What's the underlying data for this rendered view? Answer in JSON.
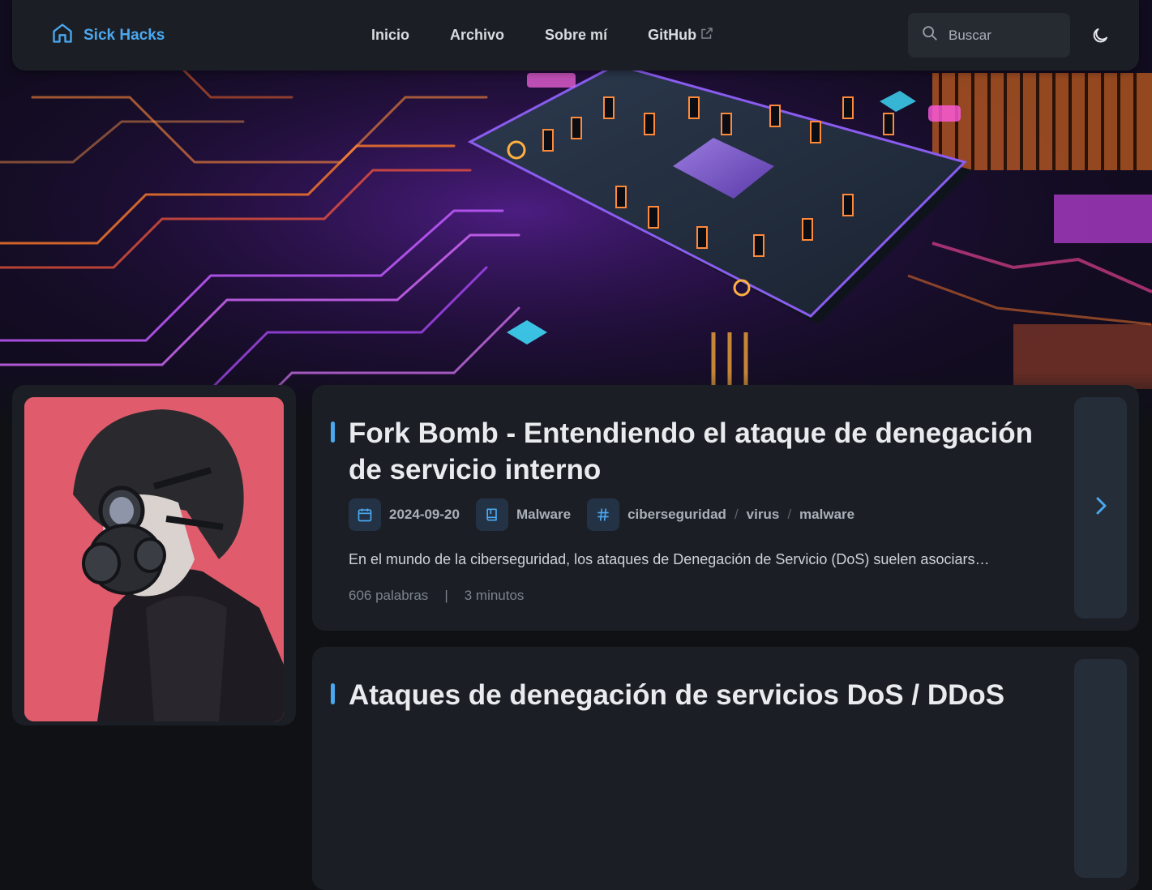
{
  "navbar": {
    "brand": "Sick Hacks",
    "links": [
      {
        "label": "Inicio"
      },
      {
        "label": "Archivo"
      },
      {
        "label": "Sobre mí"
      },
      {
        "label": "GitHub",
        "external": true
      }
    ],
    "search_placeholder": "Buscar"
  },
  "posts": [
    {
      "title": "Fork Bomb - Entendiendo el ataque de denegación de servicio interno",
      "date": "2024-09-20",
      "category": "Malware",
      "tags": [
        "ciberseguridad",
        "virus",
        "malware"
      ],
      "excerpt": "En el mundo de la ciberseguridad, los ataques de Denegación de Servicio (DoS) suelen asociars…",
      "words": "606 palabras",
      "stats_separator": "|",
      "read_time": "3 minutos"
    },
    {
      "title": "Ataques de denegación de servicios DoS / DDoS"
    }
  ],
  "colors": {
    "accent": "#4aa8f0",
    "card": "#1b1f25",
    "page": "#0f1115",
    "avatar_bg": "#e05c6c"
  },
  "icons": [
    "home-icon",
    "external-link-icon",
    "search-icon",
    "moon-icon",
    "calendar-icon",
    "book-icon",
    "hash-icon",
    "chevron-right-icon"
  ]
}
